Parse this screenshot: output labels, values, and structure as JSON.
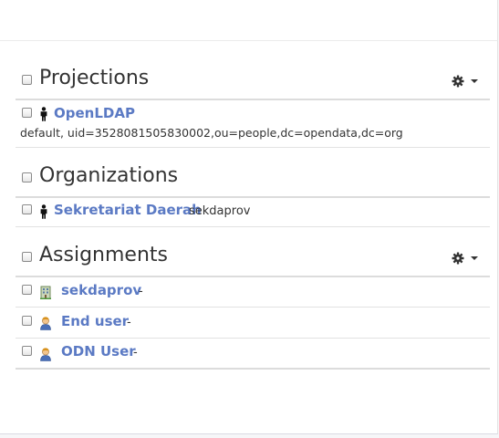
{
  "sections": {
    "projections": {
      "title": "Projections",
      "items": [
        {
          "name": "OpenLDAP",
          "description": "default, uid=3528081505830002,ou=people,dc=opendata,dc=org",
          "icon": "person-icon"
        }
      ]
    },
    "organizations": {
      "title": "Organizations",
      "items": [
        {
          "name": "Sekretariat Daerah",
          "detail": "sekdaprov",
          "icon": "person-icon"
        }
      ]
    },
    "assignments": {
      "title": "Assignments",
      "items": [
        {
          "name": "sekdaprov",
          "detail": "-",
          "icon": "building-icon"
        },
        {
          "name": "End user",
          "detail": "-",
          "icon": "user-role-icon"
        },
        {
          "name": "ODN User",
          "detail": "-",
          "icon": "user-role-icon"
        }
      ]
    }
  },
  "colors": {
    "link": "#5b7ac4",
    "text": "#333333",
    "divider": "#dcdcdc"
  }
}
